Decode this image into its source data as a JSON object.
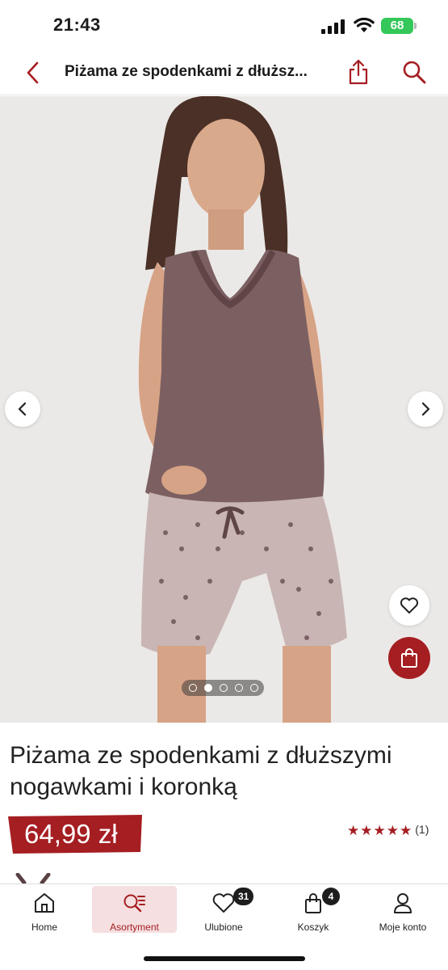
{
  "status_bar": {
    "time": "21:43",
    "battery": "68",
    "icons": [
      "signal-icon",
      "wifi-icon",
      "battery-icon"
    ]
  },
  "header": {
    "title": "Piżama ze spodenkami z dłuższ...",
    "icons": [
      "chevron-left-icon",
      "share-icon",
      "search-icon"
    ]
  },
  "gallery": {
    "image_count": 5,
    "active_index": 1,
    "icons": [
      "chevron-left-icon",
      "chevron-right-icon",
      "heart-icon",
      "shopping-bag-icon"
    ]
  },
  "product": {
    "title": "Piżama ze spodenkami z dłuższymi nogawkami i koronką",
    "price": "64,99 zł",
    "rating_stars": 5,
    "rating_count": "(1)"
  },
  "bottom_nav": {
    "items": [
      {
        "label": "Home",
        "icon": "home-icon"
      },
      {
        "label": "Asortyment",
        "icon": "catalog-search-icon",
        "active": true
      },
      {
        "label": "Ulubione",
        "icon": "heart-icon",
        "badge": "31"
      },
      {
        "label": "Koszyk",
        "icon": "shopping-bag-icon",
        "badge": "4"
      },
      {
        "label": "Moje konto",
        "icon": "user-icon"
      }
    ]
  },
  "colors": {
    "accent": "#a51e22",
    "active_nav_bg": "#f5dfe0",
    "photo_bg": "#ebe9e7",
    "top_color": "#7c6061",
    "shorts_color": "#c9b6b4"
  }
}
